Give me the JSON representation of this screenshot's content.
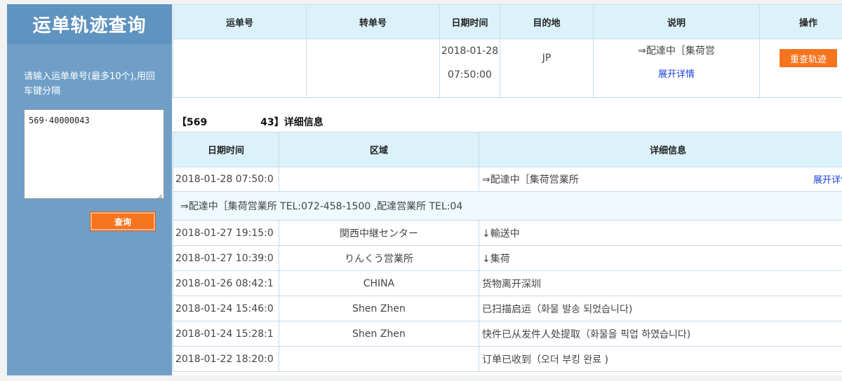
{
  "sidebar": {
    "title": "运单轨迹查询",
    "hint": "请输入运单单号(最多10个),用回车键分隔",
    "input_value": "569·40000043",
    "query_label": "查询"
  },
  "summary": {
    "headers": [
      "运单号",
      "转单号",
      "日期时间",
      "目的地",
      "说明",
      "操作"
    ],
    "row": {
      "waybill": "",
      "transfer": "",
      "date": "2018-01-28",
      "time": "07:50:00",
      "destination": "JP",
      "description": "⇒配達中［集荷営",
      "expand_label": "展开详情",
      "retrack_label": "重查轨迹"
    }
  },
  "detail": {
    "title_prefix": "【569",
    "title_suffix": "43】详细信息",
    "headers": [
      "日期时间",
      "区域",
      "详细信息"
    ],
    "first": {
      "time": "2018-01-28 07:50:0",
      "region": "",
      "info": "⇒配達中［集荷営業所 ",
      "expand_label": "展开详情"
    },
    "expanded_text": "⇒配達中［集荷営業所 TEL:072-458-1500 ,配達営業所 TEL:04",
    "rows": [
      {
        "time": "2018-01-27 19:15:0",
        "region": "関西中継センター",
        "info": "↓輸送中"
      },
      {
        "time": "2018-01-27 10:39:0",
        "region": "りんくう営業所",
        "info": "↓集荷"
      },
      {
        "time": "2018-01-26 08:42:1",
        "region": "CHINA",
        "info": "货物离开深圳"
      },
      {
        "time": "2018-01-24 15:46:0",
        "region": "Shen Zhen",
        "info": "已扫描启运（화물 발송 되었습니다)"
      },
      {
        "time": "2018-01-24 15:28:1",
        "region": "Shen Zhen",
        "info": "快件已从发件人处提取（화물을 픽업 하였습니다)"
      },
      {
        "time": "2018-01-22 18:20:0",
        "region": "",
        "info": "订单已收到（오더 부킹 완료 )"
      }
    ]
  },
  "colors": {
    "sidebar_bg": "#6f9fc7",
    "header_bg": "#dcf2fb",
    "accent_orange": "#f7741f",
    "link_blue": "#1a3fd6"
  }
}
